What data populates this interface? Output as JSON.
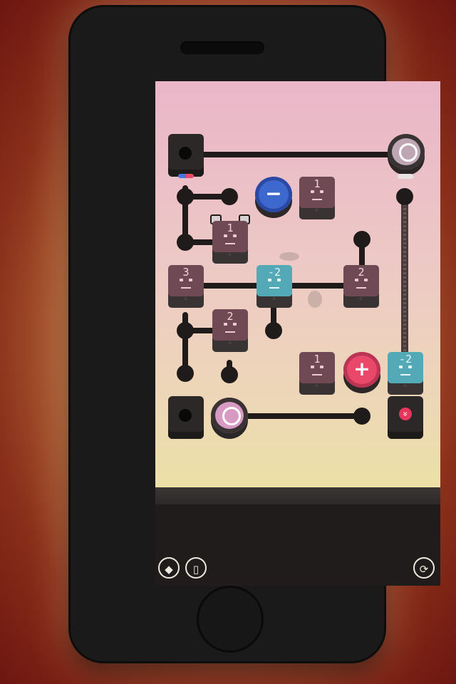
{
  "tiles": [
    {
      "id": "t1",
      "value": "1",
      "type": "red"
    },
    {
      "id": "t2",
      "value": "1",
      "type": "red"
    },
    {
      "id": "t3",
      "value": "3",
      "type": "red"
    },
    {
      "id": "t4",
      "value": "-2",
      "type": "teal"
    },
    {
      "id": "t5",
      "value": "2",
      "type": "red"
    },
    {
      "id": "t6",
      "value": "2",
      "type": "red"
    },
    {
      "id": "t7",
      "value": "1",
      "type": "red"
    },
    {
      "id": "t8",
      "value": "-2",
      "type": "teal"
    }
  ],
  "buttons": {
    "minus_symbol": "−",
    "plus_symbol": "+",
    "exit_symbol": "»"
  },
  "controls": {
    "hint_icon": "◆",
    "device_icon": "▯",
    "restart_icon": "⟳"
  },
  "colors": {
    "blue_button": "#3d69cf",
    "plus_button": "#e9486a",
    "tile_red": "#6f4a55",
    "tile_teal": "#54a9b6",
    "exit_accent": "#e6365c"
  }
}
